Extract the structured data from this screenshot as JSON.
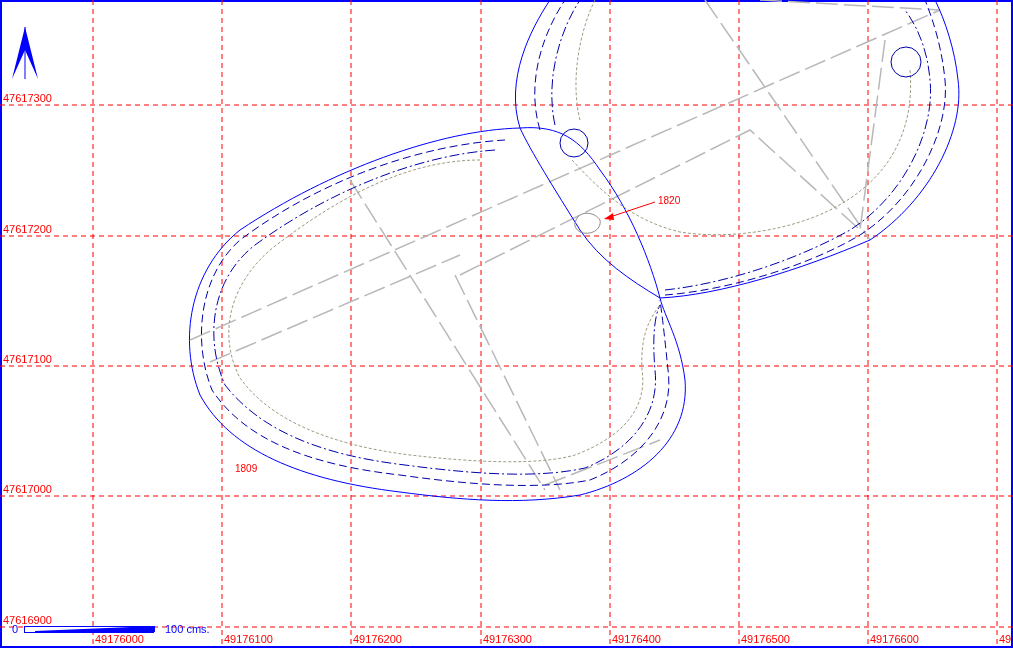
{
  "y_labels": [
    "47617300",
    "47617200",
    "47617100",
    "47617000",
    "47616900"
  ],
  "x_labels": [
    "49176000",
    "49176100",
    "49176200",
    "49176300",
    "49176400",
    "49176500",
    "49176600",
    "49"
  ],
  "annotations": [
    {
      "text": "1820",
      "kind": "leader"
    },
    {
      "text": "1809",
      "kind": "plain"
    }
  ],
  "scale_bar": {
    "start": "0",
    "end": "100 cms."
  }
}
